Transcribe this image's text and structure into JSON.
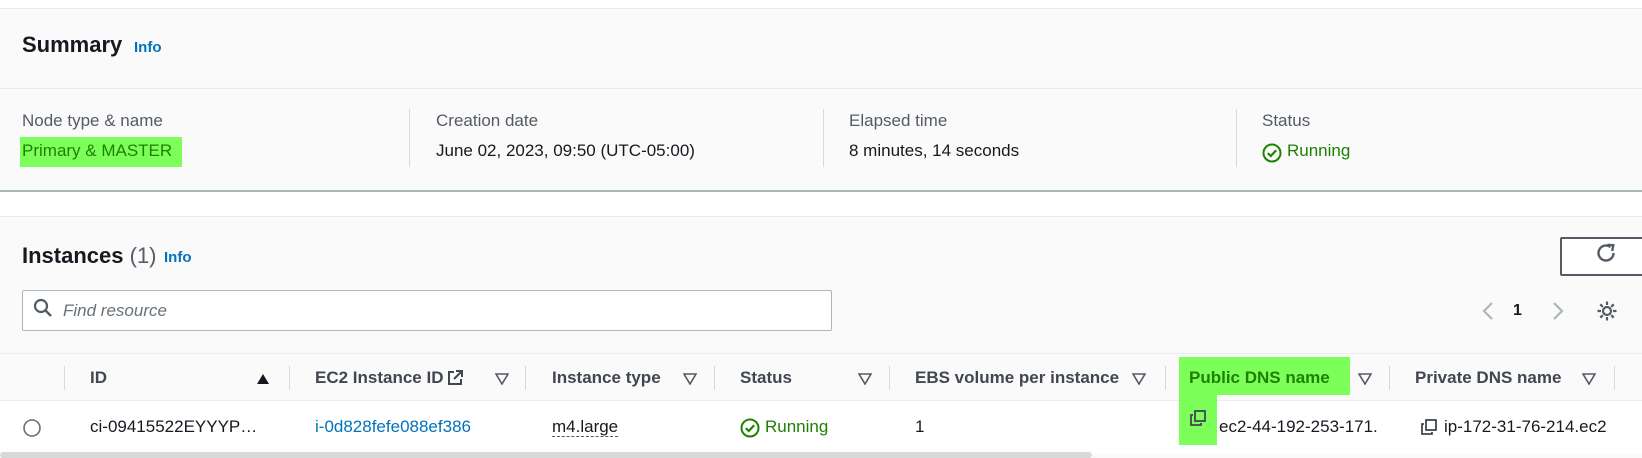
{
  "summary": {
    "title": "Summary",
    "info": "Info",
    "fields": [
      {
        "label": "Node type & name",
        "value": "Primary & MASTER"
      },
      {
        "label": "Creation date",
        "value": "June 02, 2023, 09:50 (UTC-05:00)"
      },
      {
        "label": "Elapsed time",
        "value": "8 minutes, 14 seconds"
      },
      {
        "label": "Status",
        "value": "Running"
      }
    ]
  },
  "instances": {
    "title": "Instances",
    "count": "(1)",
    "info": "Info",
    "search_placeholder": "Find resource",
    "page": "1",
    "columns": [
      "ID",
      "EC2 Instance ID",
      "Instance type",
      "Status",
      "EBS volume per instance",
      "Public DNS name",
      "Private DNS name"
    ],
    "rows": [
      {
        "id": "ci-09415522EYYYP…",
        "ec2_id": "i-0d828fefe088ef386",
        "type": "m4.large",
        "status": "Running",
        "ebs": "1",
        "public_dns": "ec2-44-192-253-171.",
        "private_dns": "ip-172-31-76-214.ec2"
      }
    ]
  },
  "colors": {
    "accent": "#0073bb",
    "success": "#1d8102",
    "highlight": "#7dff5a"
  }
}
